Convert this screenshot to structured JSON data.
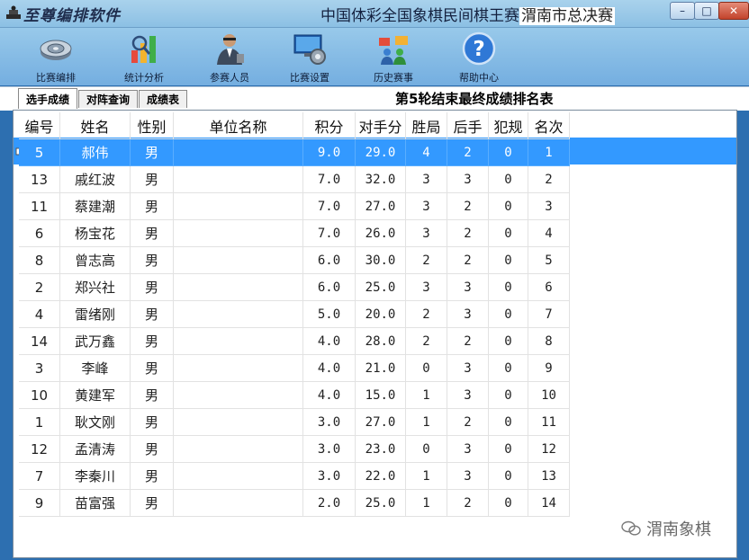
{
  "app": {
    "name": "至尊编排软件",
    "window_title_prefix": "中国体彩全国象棋民间棋王赛",
    "window_title_highlight": "渭南市总决赛"
  },
  "window_controls": {
    "minimize": "–",
    "maximize": "□",
    "close": "✕"
  },
  "toolbar": [
    {
      "label": "比赛编排",
      "icon": "disc-icon"
    },
    {
      "label": "统计分析",
      "icon": "chart-icon"
    },
    {
      "label": "参赛人员",
      "icon": "person-icon"
    },
    {
      "label": "比赛设置",
      "icon": "settings-icon"
    },
    {
      "label": "历史赛事",
      "icon": "group-icon"
    },
    {
      "label": "帮助中心",
      "icon": "help-icon"
    }
  ],
  "tabs": [
    {
      "label": "选手成绩",
      "active": true
    },
    {
      "label": "对阵查询",
      "active": false
    },
    {
      "label": "成绩表",
      "active": false
    }
  ],
  "table_title": "第5轮结束最终成绩排名表",
  "columns": [
    "编号",
    "姓名",
    "性别",
    "单位名称",
    "积分",
    "对手分",
    "胜局",
    "后手",
    "犯规",
    "名次"
  ],
  "rows": [
    [
      "5",
      "郝伟",
      "男",
      "",
      "9.0",
      "29.0",
      "4",
      "2",
      "0",
      "1"
    ],
    [
      "13",
      "戚红波",
      "男",
      "",
      "7.0",
      "32.0",
      "3",
      "3",
      "0",
      "2"
    ],
    [
      "11",
      "蔡建潮",
      "男",
      "",
      "7.0",
      "27.0",
      "3",
      "2",
      "0",
      "3"
    ],
    [
      "6",
      "杨宝花",
      "男",
      "",
      "7.0",
      "26.0",
      "3",
      "2",
      "0",
      "4"
    ],
    [
      "8",
      "曾志高",
      "男",
      "",
      "6.0",
      "30.0",
      "2",
      "2",
      "0",
      "5"
    ],
    [
      "2",
      "郑兴社",
      "男",
      "",
      "6.0",
      "25.0",
      "3",
      "3",
      "0",
      "6"
    ],
    [
      "4",
      "雷绪刚",
      "男",
      "",
      "5.0",
      "20.0",
      "2",
      "3",
      "0",
      "7"
    ],
    [
      "14",
      "武万鑫",
      "男",
      "",
      "4.0",
      "28.0",
      "2",
      "2",
      "0",
      "8"
    ],
    [
      "3",
      "李峰",
      "男",
      "",
      "4.0",
      "21.0",
      "0",
      "3",
      "0",
      "9"
    ],
    [
      "10",
      "黄建军",
      "男",
      "",
      "4.0",
      "15.0",
      "1",
      "3",
      "0",
      "10"
    ],
    [
      "1",
      "耿文刚",
      "男",
      "",
      "3.0",
      "27.0",
      "1",
      "2",
      "0",
      "11"
    ],
    [
      "12",
      "孟清涛",
      "男",
      "",
      "3.0",
      "23.0",
      "0",
      "3",
      "0",
      "12"
    ],
    [
      "7",
      "李秦川",
      "男",
      "",
      "3.0",
      "22.0",
      "1",
      "3",
      "0",
      "13"
    ],
    [
      "9",
      "苗富强",
      "男",
      "",
      "2.0",
      "25.0",
      "1",
      "2",
      "0",
      "14"
    ]
  ],
  "selected_row": 0,
  "watermark": "渭南象棋",
  "colors": {
    "selection": "#3399ff",
    "titlebar": "#a9d2ec",
    "toolbar": "#74aee0"
  }
}
